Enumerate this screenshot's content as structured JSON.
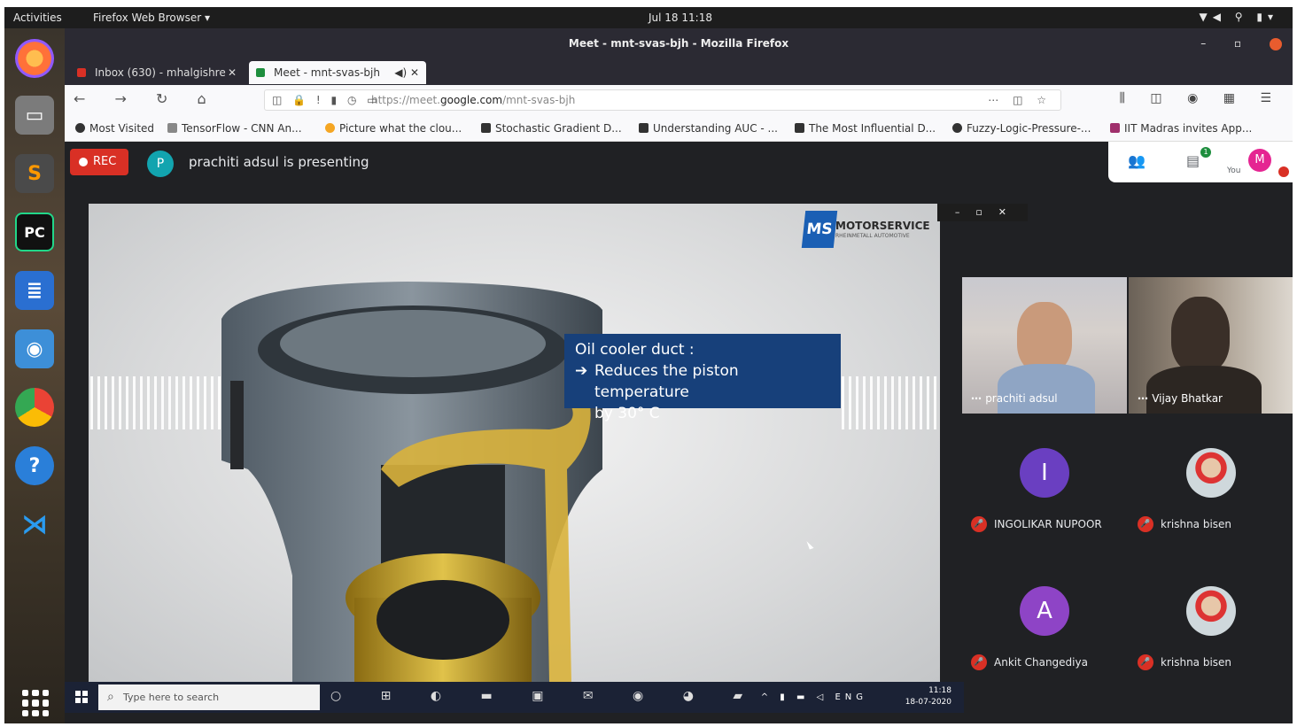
{
  "topbar": {
    "activities": "Activities",
    "app": "Firefox Web Browser ▾",
    "clock": "Jul 18  11:18"
  },
  "window": {
    "title": "Meet - mnt-svas-bjh - Mozilla Firefox"
  },
  "tabs": [
    {
      "label": "Inbox (630) - mhalgishre",
      "color": "#d93025"
    },
    {
      "label": "Meet - mnt-svas-bjh",
      "color": "#1e8e3e"
    }
  ],
  "url": {
    "prefix": "https://meet.",
    "domain": "google.com",
    "path": "/mnt-svas-bjh"
  },
  "bookmarks": [
    "Most Visited",
    "TensorFlow - CNN An...",
    "Picture what the clou...",
    "Stochastic Gradient D...",
    "Understanding AUC - ...",
    "The Most Influential D...",
    "Fuzzy-Logic-Pressure-...",
    "IIT Madras invites App..."
  ],
  "meet": {
    "rec_label": "REC",
    "presenter_initial": "P",
    "presenting_text": "prachiti adsul is presenting",
    "chat_badge": "1",
    "self_initial": "M",
    "self_label": "You"
  },
  "slide": {
    "logo_mark": "MS",
    "logo_text": "MOTORSERVICE",
    "logo_sub": "RHEINMETALL AUTOMOTIVE",
    "callout_title": "Oil cooler duct :",
    "callout_arrow": "➔",
    "callout_line2": "Reduces the piston temperature",
    "callout_line3": "by 30° C"
  },
  "taskbar": {
    "search_placeholder": "Type here to search",
    "time": "11:18",
    "date": "18-07-2020"
  },
  "participants": [
    {
      "name": "prachiti adsul",
      "type": "video"
    },
    {
      "name": "Vijay Bhatkar",
      "type": "video"
    },
    {
      "name": "INGOLIKAR NUPOOR",
      "initial": "I",
      "color": "#6a3fc1"
    },
    {
      "name": "krishna bisen",
      "initial": "",
      "color": "image"
    },
    {
      "name": "Ankit Changediya",
      "initial": "A",
      "color": "#8e44c6"
    },
    {
      "name": "krishna bisen",
      "initial": "",
      "color": "image"
    }
  ]
}
